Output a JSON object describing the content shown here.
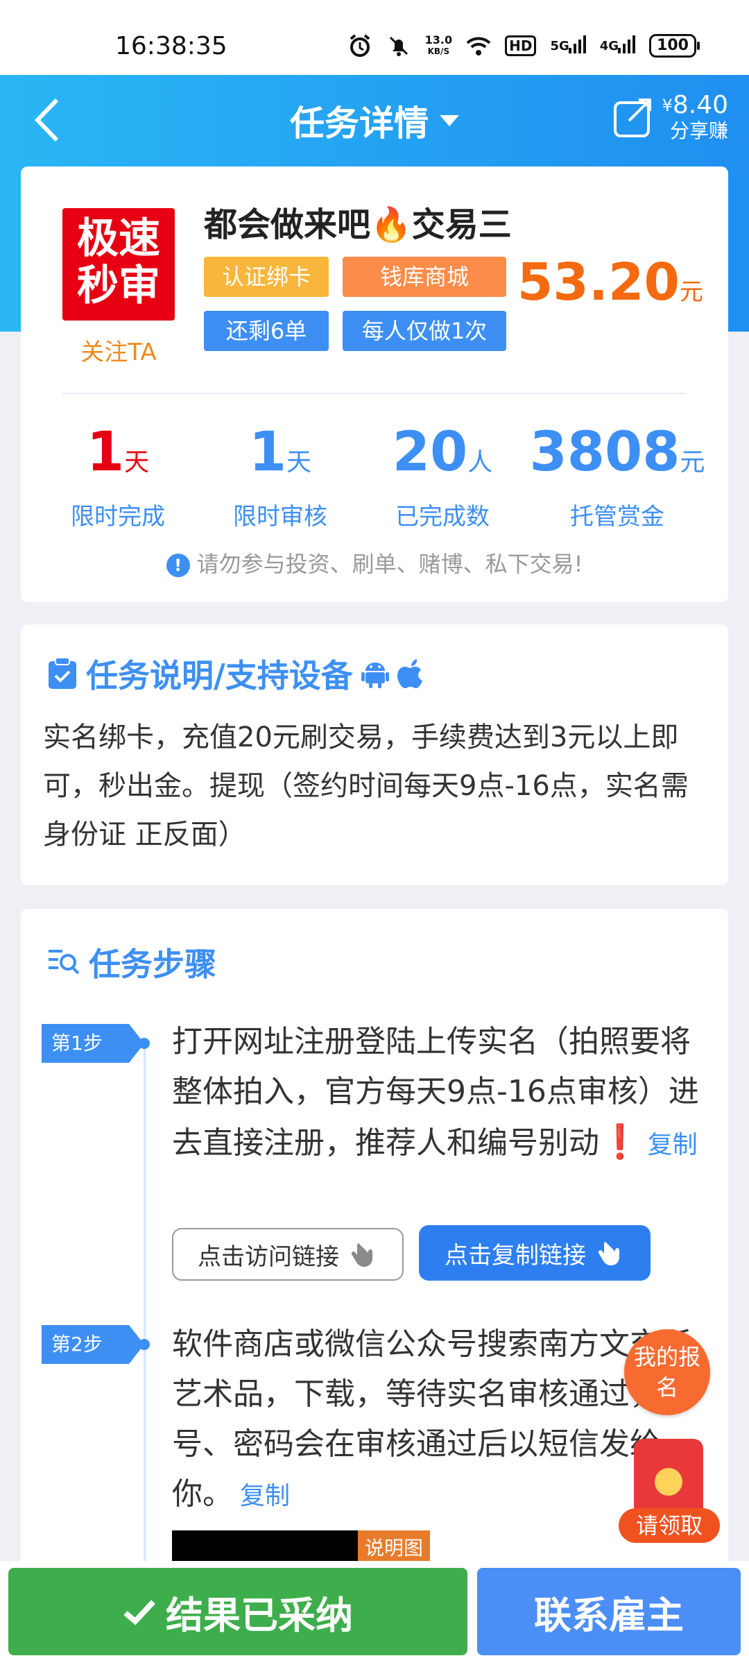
{
  "status_bar": {
    "time": "16:38:35",
    "net_speed": "13.0",
    "net_speed_unit": "KB/S",
    "hd": "HD",
    "net1": "5G",
    "net2": "4G",
    "battery": "100"
  },
  "header": {
    "title": "任务详情",
    "share_currency": "¥",
    "share_amount": "8.40",
    "share_label": "分享赚"
  },
  "task": {
    "logo_line1": "极速",
    "logo_line2": "秒审",
    "follow": "关注TA",
    "title": "都会做来吧🔥交易三",
    "tags": [
      "认证绑卡",
      "钱库商城",
      "还剩6单",
      "每人仅做1次"
    ],
    "price": "53.20",
    "price_unit": "元"
  },
  "stats": [
    {
      "value": "1",
      "unit": "天",
      "label": "限时完成"
    },
    {
      "value": "1",
      "unit": "天",
      "label": "限时审核"
    },
    {
      "value": "20",
      "unit": "人",
      "label": "已完成数"
    },
    {
      "value": "3808",
      "unit": "元",
      "label": "托管赏金"
    }
  ],
  "warning": "请勿参与投资、刷单、赌博、私下交易!",
  "description": {
    "title": "任务说明/支持设备",
    "text": "实名绑卡，充值20元刷交易，手续费达到3元以上即可，秒出金。提现（签约时间每天9点-16点，实名需身份证 正反面）"
  },
  "steps": {
    "title": "任务步骤",
    "items": [
      {
        "badge": "第1步",
        "text": "打开网址注册登陆上传实名（拍照要将整体拍入，官方每天9点-16点审核）进去直接注册，推荐人和编号别动",
        "mark": "❗",
        "copy": "复制",
        "visit_button": "点击访问链接",
        "copy_button": "点击复制链接"
      },
      {
        "badge": "第2步",
        "text": "软件商店或微信公众号搜索南方文交所艺术品，下载，等待实名审核通过，账号、密码会在审核通过后以短信发给你。",
        "copy": "复制",
        "image_label": "说明图"
      }
    ]
  },
  "floating": {
    "signup": "我的报名",
    "redpack": "请领取"
  },
  "bottom": {
    "accepted": "结果已采纳",
    "contact": "联系雇主"
  },
  "colors": {
    "primary_blue": "#3d8ff3",
    "price_orange": "#f46a10",
    "accent_red": "#e60012",
    "accept_green": "#3eae4c"
  }
}
